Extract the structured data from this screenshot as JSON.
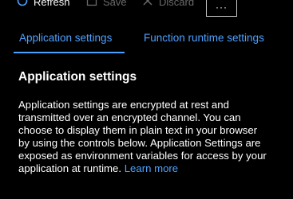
{
  "toolbar": {
    "refresh_label": "Refresh",
    "save_label": "Save",
    "discard_label": "Discard",
    "more_label": "···"
  },
  "tabs": [
    {
      "label": "Application settings",
      "active": true
    },
    {
      "label": "Function runtime settings",
      "active": false
    }
  ],
  "section": {
    "title": "Application settings",
    "description_lines": [
      "Application settings are encrypted at rest and",
      "transmitted over an encrypted channel. You can",
      "choose to display them in plain text in your browser",
      "by using the controls below. Application Settings are",
      "exposed as environment variables for access by your",
      "application at runtime."
    ],
    "learn_more": "Learn more"
  },
  "colors": {
    "background": "#000000",
    "accent": "#4ea1ff",
    "disabled_text": "#6b6b6b",
    "text": "#ffffff"
  },
  "icons": {
    "refresh": "refresh-icon",
    "save": "save-icon",
    "discard": "close-icon",
    "more": "more-icon"
  }
}
